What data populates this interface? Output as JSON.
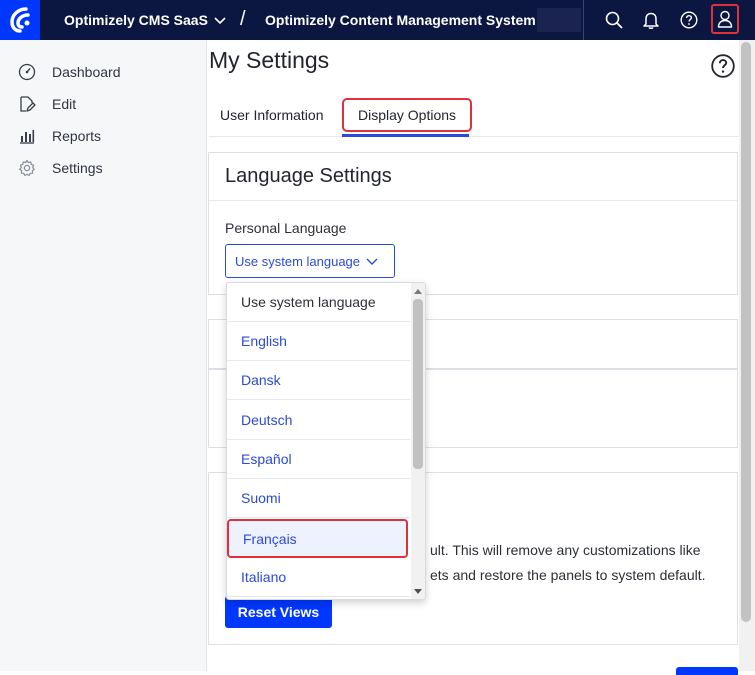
{
  "topbar": {
    "product": "Optimizely CMS SaaS",
    "separator": "/",
    "app_title": "Optimizely Content Management System",
    "icons": [
      "logo-icon",
      "search-icon",
      "bell-icon",
      "help-icon",
      "user-icon"
    ]
  },
  "sidebar": {
    "items": [
      {
        "label": "Dashboard",
        "icon": "dashboard-icon"
      },
      {
        "label": "Edit",
        "icon": "edit-icon"
      },
      {
        "label": "Reports",
        "icon": "reports-icon"
      },
      {
        "label": "Settings",
        "icon": "settings-icon"
      }
    ]
  },
  "main": {
    "title": "My Settings",
    "tabs": [
      {
        "label": "User Information"
      },
      {
        "label": "Display Options"
      }
    ],
    "language_settings": {
      "title": "Language Settings",
      "field_label": "Personal Language",
      "selected": "Use system language"
    },
    "reset": {
      "text_line1": "ult. This will remove any customizations like",
      "text_line2": "ets and restore the panels to system default.",
      "button": "Reset Views"
    }
  },
  "dropdown": {
    "options": [
      "Use system language",
      "English",
      "Dansk",
      "Deutsch",
      "Español",
      "Suomi",
      "Français",
      "Italiano"
    ],
    "highlighted": "Français"
  },
  "colors": {
    "topbar": "#0b1641",
    "brand_blue": "#0037ff",
    "link_blue": "#2a4ad8",
    "highlight_red": "#e0313b"
  }
}
